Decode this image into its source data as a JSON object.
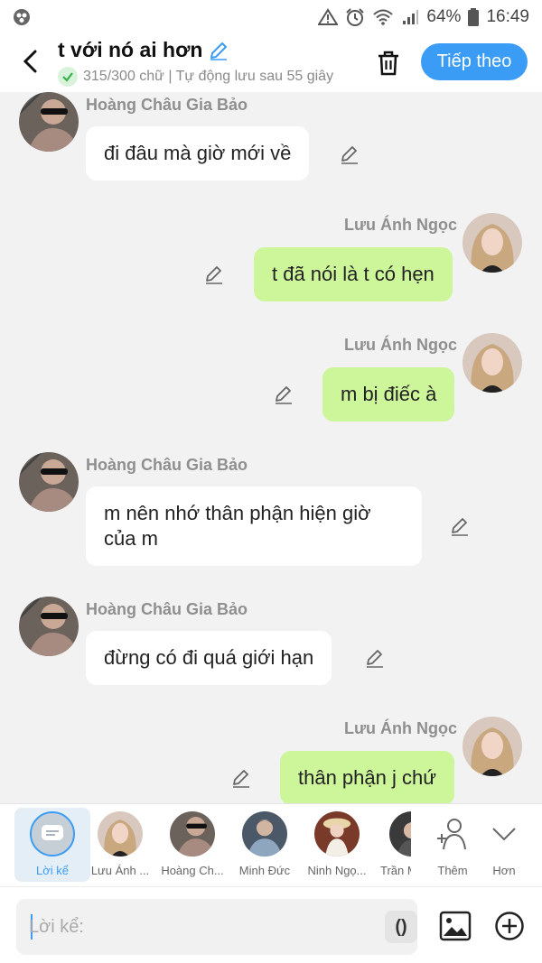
{
  "status_bar": {
    "battery": "64%",
    "time": "16:49"
  },
  "header": {
    "title": "t với nó ai hơn",
    "subtitle": "315/300 chữ | Tự động lưu sau 55 giây",
    "next_label": "Tiếp theo"
  },
  "messages": [
    {
      "side": "left",
      "sender": "Hoàng Châu Gia Bảo",
      "text": "đi đâu mà giờ mới về"
    },
    {
      "side": "right",
      "sender": "Lưu Ánh Ngọc",
      "text": "t đã nói là t có hẹn"
    },
    {
      "side": "right",
      "sender": "Lưu Ánh Ngọc",
      "text": "m bị điếc à"
    },
    {
      "side": "left",
      "sender": "Hoàng Châu Gia Bảo",
      "text": "m nên nhớ thân phận hiện giờ của m"
    },
    {
      "side": "left",
      "sender": "Hoàng Châu Gia Bảo",
      "text": "đừng có đi quá giới hạn"
    },
    {
      "side": "right",
      "sender": "Lưu Ánh Ngọc",
      "text": "thân phận j chứ"
    }
  ],
  "picker": {
    "narrator_label": "Lời kể",
    "characters": [
      "Lưu Ánh ...",
      "Hoàng Ch...",
      "Minh Đức",
      "Ninh Ngọ...",
      "Trần M"
    ],
    "more_label": "Thêm",
    "collapse_label": "Hơn"
  },
  "input": {
    "placeholder": "Lời kể:",
    "paren_label": "()"
  },
  "colors": {
    "accent": "#3b9cf5",
    "right_bubble": "#cdf59a",
    "left_bubble": "#ffffff",
    "background": "#f2f2f2"
  }
}
